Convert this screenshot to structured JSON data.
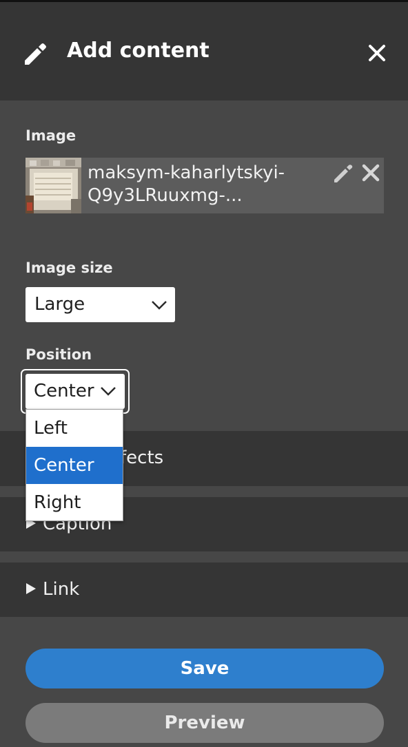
{
  "header": {
    "title": "Add content",
    "edit_icon": "pencil-icon",
    "close_icon": "close-icon"
  },
  "image_field": {
    "label": "Image",
    "filename": "maksym-kaharlytskyi-Q9y3LRuuxmg-...",
    "edit_icon": "pencil-icon",
    "remove_icon": "close-icon"
  },
  "image_size": {
    "label": "Image size",
    "value": "Large"
  },
  "position": {
    "label": "Position",
    "value": "Center",
    "options": [
      "Left",
      "Center",
      "Right"
    ],
    "selected": "Center"
  },
  "sections": {
    "effects_partial": "fects",
    "caption": "Caption",
    "link": "Link"
  },
  "buttons": {
    "save": "Save",
    "preview": "Preview"
  },
  "colors": {
    "accent": "#2e7fcd",
    "selected_option": "#1f6fcc",
    "panel": "#474747",
    "section": "#353535"
  }
}
